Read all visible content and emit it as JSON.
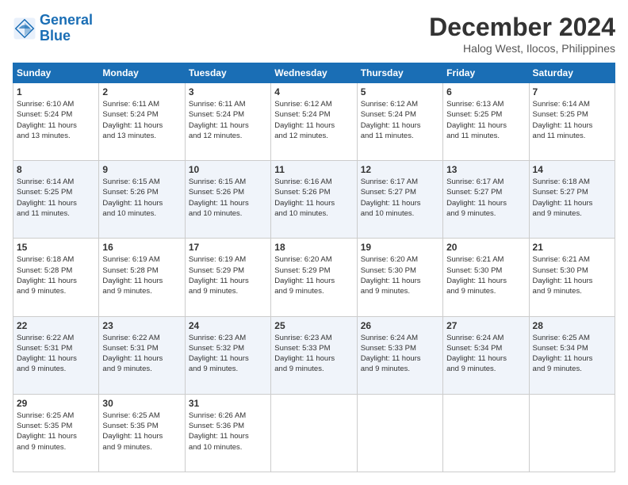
{
  "logo": {
    "line1": "General",
    "line2": "Blue"
  },
  "title": "December 2024",
  "location": "Halog West, Ilocos, Philippines",
  "headers": [
    "Sunday",
    "Monday",
    "Tuesday",
    "Wednesday",
    "Thursday",
    "Friday",
    "Saturday"
  ],
  "weeks": [
    [
      {
        "day": "1",
        "lines": [
          "Sunrise: 6:10 AM",
          "Sunset: 5:24 PM",
          "Daylight: 11 hours",
          "and 13 minutes."
        ]
      },
      {
        "day": "2",
        "lines": [
          "Sunrise: 6:11 AM",
          "Sunset: 5:24 PM",
          "Daylight: 11 hours",
          "and 13 minutes."
        ]
      },
      {
        "day": "3",
        "lines": [
          "Sunrise: 6:11 AM",
          "Sunset: 5:24 PM",
          "Daylight: 11 hours",
          "and 12 minutes."
        ]
      },
      {
        "day": "4",
        "lines": [
          "Sunrise: 6:12 AM",
          "Sunset: 5:24 PM",
          "Daylight: 11 hours",
          "and 12 minutes."
        ]
      },
      {
        "day": "5",
        "lines": [
          "Sunrise: 6:12 AM",
          "Sunset: 5:24 PM",
          "Daylight: 11 hours",
          "and 11 minutes."
        ]
      },
      {
        "day": "6",
        "lines": [
          "Sunrise: 6:13 AM",
          "Sunset: 5:25 PM",
          "Daylight: 11 hours",
          "and 11 minutes."
        ]
      },
      {
        "day": "7",
        "lines": [
          "Sunrise: 6:14 AM",
          "Sunset: 5:25 PM",
          "Daylight: 11 hours",
          "and 11 minutes."
        ]
      }
    ],
    [
      {
        "day": "8",
        "lines": [
          "Sunrise: 6:14 AM",
          "Sunset: 5:25 PM",
          "Daylight: 11 hours",
          "and 11 minutes."
        ]
      },
      {
        "day": "9",
        "lines": [
          "Sunrise: 6:15 AM",
          "Sunset: 5:26 PM",
          "Daylight: 11 hours",
          "and 10 minutes."
        ]
      },
      {
        "day": "10",
        "lines": [
          "Sunrise: 6:15 AM",
          "Sunset: 5:26 PM",
          "Daylight: 11 hours",
          "and 10 minutes."
        ]
      },
      {
        "day": "11",
        "lines": [
          "Sunrise: 6:16 AM",
          "Sunset: 5:26 PM",
          "Daylight: 11 hours",
          "and 10 minutes."
        ]
      },
      {
        "day": "12",
        "lines": [
          "Sunrise: 6:17 AM",
          "Sunset: 5:27 PM",
          "Daylight: 11 hours",
          "and 10 minutes."
        ]
      },
      {
        "day": "13",
        "lines": [
          "Sunrise: 6:17 AM",
          "Sunset: 5:27 PM",
          "Daylight: 11 hours",
          "and 9 minutes."
        ]
      },
      {
        "day": "14",
        "lines": [
          "Sunrise: 6:18 AM",
          "Sunset: 5:27 PM",
          "Daylight: 11 hours",
          "and 9 minutes."
        ]
      }
    ],
    [
      {
        "day": "15",
        "lines": [
          "Sunrise: 6:18 AM",
          "Sunset: 5:28 PM",
          "Daylight: 11 hours",
          "and 9 minutes."
        ]
      },
      {
        "day": "16",
        "lines": [
          "Sunrise: 6:19 AM",
          "Sunset: 5:28 PM",
          "Daylight: 11 hours",
          "and 9 minutes."
        ]
      },
      {
        "day": "17",
        "lines": [
          "Sunrise: 6:19 AM",
          "Sunset: 5:29 PM",
          "Daylight: 11 hours",
          "and 9 minutes."
        ]
      },
      {
        "day": "18",
        "lines": [
          "Sunrise: 6:20 AM",
          "Sunset: 5:29 PM",
          "Daylight: 11 hours",
          "and 9 minutes."
        ]
      },
      {
        "day": "19",
        "lines": [
          "Sunrise: 6:20 AM",
          "Sunset: 5:30 PM",
          "Daylight: 11 hours",
          "and 9 minutes."
        ]
      },
      {
        "day": "20",
        "lines": [
          "Sunrise: 6:21 AM",
          "Sunset: 5:30 PM",
          "Daylight: 11 hours",
          "and 9 minutes."
        ]
      },
      {
        "day": "21",
        "lines": [
          "Sunrise: 6:21 AM",
          "Sunset: 5:30 PM",
          "Daylight: 11 hours",
          "and 9 minutes."
        ]
      }
    ],
    [
      {
        "day": "22",
        "lines": [
          "Sunrise: 6:22 AM",
          "Sunset: 5:31 PM",
          "Daylight: 11 hours",
          "and 9 minutes."
        ]
      },
      {
        "day": "23",
        "lines": [
          "Sunrise: 6:22 AM",
          "Sunset: 5:31 PM",
          "Daylight: 11 hours",
          "and 9 minutes."
        ]
      },
      {
        "day": "24",
        "lines": [
          "Sunrise: 6:23 AM",
          "Sunset: 5:32 PM",
          "Daylight: 11 hours",
          "and 9 minutes."
        ]
      },
      {
        "day": "25",
        "lines": [
          "Sunrise: 6:23 AM",
          "Sunset: 5:33 PM",
          "Daylight: 11 hours",
          "and 9 minutes."
        ]
      },
      {
        "day": "26",
        "lines": [
          "Sunrise: 6:24 AM",
          "Sunset: 5:33 PM",
          "Daylight: 11 hours",
          "and 9 minutes."
        ]
      },
      {
        "day": "27",
        "lines": [
          "Sunrise: 6:24 AM",
          "Sunset: 5:34 PM",
          "Daylight: 11 hours",
          "and 9 minutes."
        ]
      },
      {
        "day": "28",
        "lines": [
          "Sunrise: 6:25 AM",
          "Sunset: 5:34 PM",
          "Daylight: 11 hours",
          "and 9 minutes."
        ]
      }
    ],
    [
      {
        "day": "29",
        "lines": [
          "Sunrise: 6:25 AM",
          "Sunset: 5:35 PM",
          "Daylight: 11 hours",
          "and 9 minutes."
        ]
      },
      {
        "day": "30",
        "lines": [
          "Sunrise: 6:25 AM",
          "Sunset: 5:35 PM",
          "Daylight: 11 hours",
          "and 9 minutes."
        ]
      },
      {
        "day": "31",
        "lines": [
          "Sunrise: 6:26 AM",
          "Sunset: 5:36 PM",
          "Daylight: 11 hours",
          "and 10 minutes."
        ]
      },
      null,
      null,
      null,
      null
    ]
  ]
}
